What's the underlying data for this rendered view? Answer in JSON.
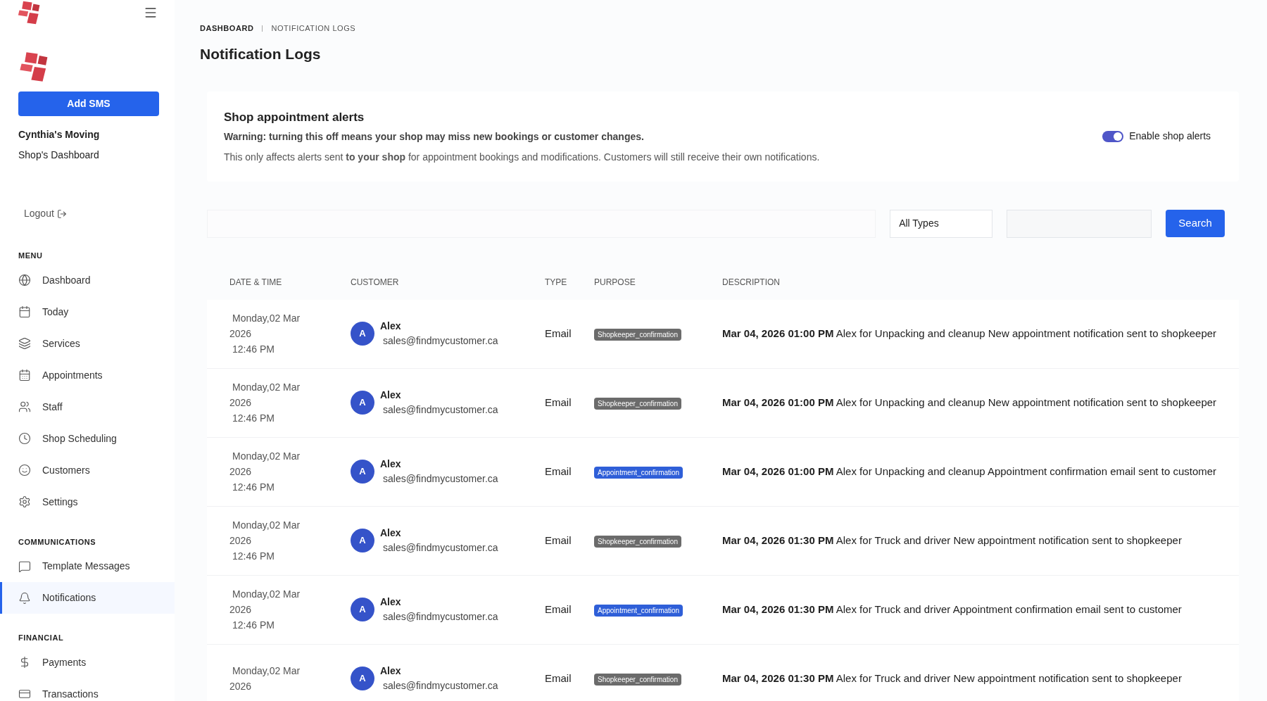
{
  "sidebar": {
    "add_button": "Add SMS",
    "shop_name": "Cynthia's Moving",
    "shop_subtitle": "Shop's Dashboard",
    "logout": "Logout",
    "sections": [
      {
        "title": "MENU",
        "items": [
          {
            "label": "Dashboard",
            "selected": false
          },
          {
            "label": "Today",
            "selected": false
          },
          {
            "label": "Services",
            "selected": false
          },
          {
            "label": "Appointments",
            "selected": false
          },
          {
            "label": "Staff",
            "selected": false
          },
          {
            "label": "Shop Scheduling",
            "selected": false
          },
          {
            "label": "Customers",
            "selected": false
          },
          {
            "label": "Settings",
            "selected": false
          }
        ]
      },
      {
        "title": "COMMUNICATIONS",
        "items": [
          {
            "label": "Template Messages",
            "selected": false
          },
          {
            "label": "Notifications",
            "selected": true
          }
        ]
      },
      {
        "title": "FINANCIAL",
        "items": [
          {
            "label": "Payments",
            "selected": false
          },
          {
            "label": "Transactions",
            "selected": false
          }
        ]
      }
    ]
  },
  "breadcrumb": [
    "DASHBOARD",
    "NOTIFICATION LOGS"
  ],
  "page_title": "Notification Logs",
  "alerts": {
    "title": "Shop appointment alerts",
    "warning": "Warning: turning this off means your shop may miss new bookings or customer changes.",
    "note": "This only affects alerts sent **to your shop** for appointment bookings and modifications. Customers will still receive their own notifications.",
    "toggle": {
      "label": "Enable shop alerts",
      "on": true
    }
  },
  "filters": {
    "type_select": "All Types",
    "search_button": "Search"
  },
  "table": {
    "columns": [
      "DATE & TIME",
      "CUSTOMER",
      "TYPE",
      "PURPOSE",
      "DESCRIPTION"
    ],
    "rows": [
      {
        "day": "Monday,02 Mar",
        "year": "2026",
        "time": "12:46 PM",
        "avatar": "A",
        "name": "Alex",
        "email": "sales@findmycustomer.ca",
        "type": "Email",
        "purpose": {
          "label": "Shopkeeper_confirmation",
          "kind": "shopkeeper"
        },
        "description": "**Mar 04, 2026 01:00 PM** Alex for Unpacking and cleanup New appointment notification sent to shopkeeper"
      },
      {
        "day": "Monday,02 Mar",
        "year": "2026",
        "time": "12:46 PM",
        "avatar": "A",
        "name": "Alex",
        "email": "sales@findmycustomer.ca",
        "type": "Email",
        "purpose": {
          "label": "Shopkeeper_confirmation",
          "kind": "shopkeeper"
        },
        "description": "**Mar 04, 2026 01:00 PM** Alex for Unpacking and cleanup New appointment notification sent to shopkeeper"
      },
      {
        "day": "Monday,02 Mar",
        "year": "2026",
        "time": "12:46 PM",
        "avatar": "A",
        "name": "Alex",
        "email": "sales@findmycustomer.ca",
        "type": "Email",
        "purpose": {
          "label": "Appointment_confirmation",
          "kind": "appointment"
        },
        "description": "**Mar 04, 2026 01:00 PM** Alex for Unpacking and cleanup Appointment confirmation email sent to customer"
      },
      {
        "day": "Monday,02 Mar",
        "year": "2026",
        "time": "12:46 PM",
        "avatar": "A",
        "name": "Alex",
        "email": "sales@findmycustomer.ca",
        "type": "Email",
        "purpose": {
          "label": "Shopkeeper_confirmation",
          "kind": "shopkeeper"
        },
        "description": "**Mar 04, 2026 01:30 PM** Alex for Truck and driver New appointment notification sent to shopkeeper"
      },
      {
        "day": "Monday,02 Mar",
        "year": "2026",
        "time": "12:46 PM",
        "avatar": "A",
        "name": "Alex",
        "email": "sales@findmycustomer.ca",
        "type": "Email",
        "purpose": {
          "label": "Appointment_confirmation",
          "kind": "appointment"
        },
        "description": "**Mar 04, 2026 01:30 PM** Alex for Truck and driver Appointment confirmation email sent to customer"
      },
      {
        "day": "Monday,02 Mar",
        "year": "2026",
        "avatar": "A",
        "name": "Alex",
        "email": "sales@findmycustomer.ca",
        "type": "Email",
        "purpose": {
          "label": "Shopkeeper_confirmation",
          "kind": "shopkeeper"
        },
        "description": "**Mar 04, 2026 01:30 PM** Alex for Truck and driver New appointment notification sent to shopkeeper"
      }
    ]
  }
}
